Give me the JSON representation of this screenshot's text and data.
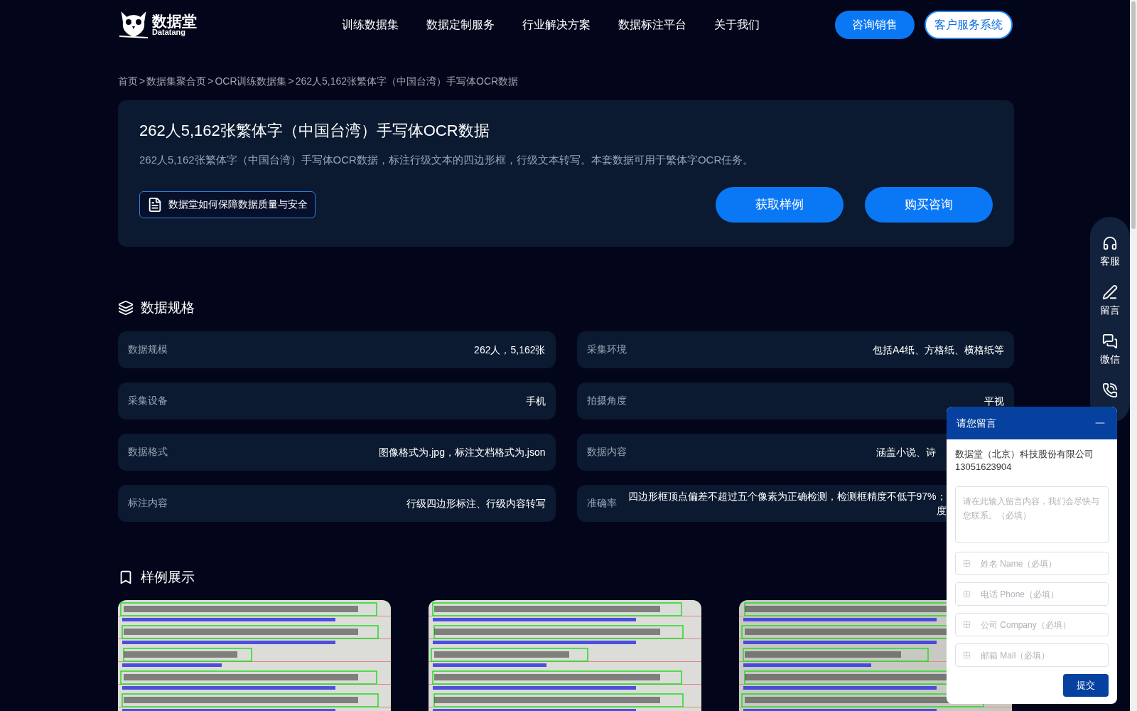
{
  "header": {
    "logo_text": "数据堂",
    "logo_subtext": "Datatang",
    "nav": [
      {
        "label": "训练数据集"
      },
      {
        "label": "数据定制服务"
      },
      {
        "label": "行业解决方案"
      },
      {
        "label": "数据标注平台"
      },
      {
        "label": "关于我们"
      }
    ],
    "buttons": [
      {
        "label": "咨询销售",
        "kind": "filled"
      },
      {
        "label": "客户服务系统",
        "kind": "outline"
      }
    ]
  },
  "breadcrumb": [
    "首页",
    "数据集聚合页",
    "OCR训练数据集",
    "262人5,162张繁体字（中国台湾）手写体OCR数据"
  ],
  "breadcrumb_separator": ">",
  "hero": {
    "title": "262人5,162张繁体字（中国台湾）手写体OCR数据",
    "description": "262人5,162张繁体字（中国台湾）手写体OCR数据，标注行级文本的四边形框，行级文本转写。本套数据可用于繁体字OCR任务。",
    "quality_link": "数据堂如何保障数据质量与安全",
    "actions": [
      "获取样例",
      "购买咨询"
    ]
  },
  "specs": {
    "title": "数据规格",
    "columns": [
      [
        {
          "label": "数据规模",
          "value": [
            "262人，5,162张"
          ]
        },
        {
          "label": "采集设备",
          "value": [
            "手机"
          ]
        },
        {
          "label": "数据格式",
          "value": [
            "图像格式为.jpg，标注文档格式为.json"
          ]
        },
        {
          "label": "标注内容",
          "value": [
            "行级四边形标注、行级内容转写"
          ]
        }
      ],
      [
        {
          "label": "采集环境",
          "value": [
            "包括A4纸、方格纸、横格纸等"
          ]
        },
        {
          "label": "拍摄角度",
          "value": [
            "平视"
          ]
        },
        {
          "label": "数据内容",
          "value": [
            "涵盖小说、诗"
          ]
        },
        {
          "label": "准确率",
          "value": [
            "四边形框顶点偏差不超过五个像素为正确检测，检测框精度不低于97%；",
            "度"
          ]
        }
      ]
    ]
  },
  "samples": {
    "title": "样例展示"
  },
  "side_bar": [
    {
      "label": "客服",
      "kind": "headset"
    },
    {
      "label": "留言",
      "kind": "pen"
    },
    {
      "label": "微信",
      "kind": "chat"
    },
    {
      "kind": "phone"
    }
  ],
  "message_widget": {
    "title": "请您留言",
    "company": "数据堂（北京）科技股份有限公司",
    "phone": "13051623904",
    "message_placeholder": "请在此输入留言内容，我们会尽快与您联系。（必填）",
    "fields": [
      {
        "placeholder": "姓名 Name（必填）"
      },
      {
        "placeholder": "电话 Phone（必填）"
      },
      {
        "placeholder": "公司 Company（必填）"
      },
      {
        "placeholder": "邮箱 Mail（必填）"
      }
    ],
    "submit": "提交"
  }
}
